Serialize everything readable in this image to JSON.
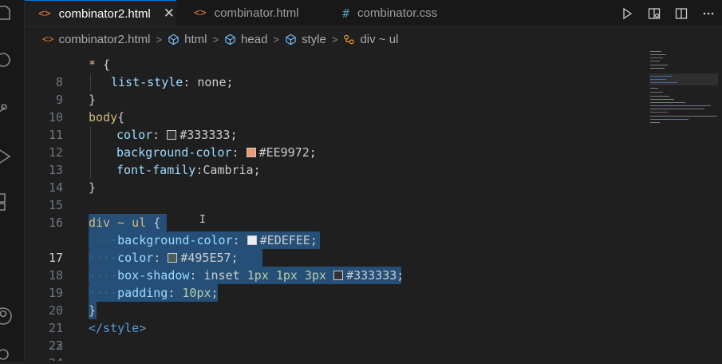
{
  "tabs": [
    {
      "icon": "<>",
      "label": "combinator2.html",
      "active": true,
      "close": "✕"
    },
    {
      "icon": "<>",
      "label": "combinator.html",
      "active": false
    },
    {
      "icon": "#",
      "label": "combinator.css",
      "active": false
    }
  ],
  "breadcrumb": [
    "combinator2.html",
    "html",
    "head",
    "style",
    "div ~ ul"
  ],
  "editor": {
    "line_numbers": [
      "8",
      "9",
      "10",
      "11",
      "12",
      "13",
      "14",
      "15",
      "16",
      "17",
      "18",
      "19",
      "20",
      "21",
      "22",
      "23",
      "24"
    ],
    "current_line": "17",
    "code": {
      "l8_sel": "*",
      "l8_brace": " {",
      "l9_prop": "list-style",
      "l9_rest": ": none;",
      "l10": "}",
      "l11_sel": "body",
      "l11_brace": "{",
      "l12_prop": "color",
      "l12_colon": ": ",
      "l12_hex": "#333333",
      "l12_semi": ";",
      "l13_prop": "background-color",
      "l13_colon": ": ",
      "l13_hex": "#EE9972",
      "l13_semi": ";",
      "l14_prop": "font-family",
      "l14_rest": ":Cambria;",
      "l17_sel": "div ~ ul",
      "l17_brace": " {",
      "l18_prop": "background-color",
      "l18_colon": ": ",
      "l18_hex": "#EDEFEE",
      "l18_semi": ";",
      "l19_prop": "color",
      "l19_colon": ": ",
      "l19_hex": "#495E57",
      "l19_semi": ";",
      "l20_prop": "box-shadow",
      "l20_colon": ": ",
      "l20_inset": "inset",
      "l20_n1": "1px",
      "l20_n2": "1px",
      "l20_n3": "3px",
      "l20_hex": "#333333",
      "l20_semi": ";",
      "l21_prop": "padding",
      "l21_colon": ": ",
      "l21_num": "10px",
      "l21_semi": ";",
      "l22": "}",
      "l23": "</style>"
    }
  },
  "colors": {
    "swatch_333333": "#333333",
    "swatch_EE9972": "#EE9972",
    "swatch_EDEFEE": "#EDEFEE",
    "swatch_495E57": "#495E57",
    "selection": "#264f78",
    "accent": "#0078d4"
  },
  "icons": {
    "activity": [
      "files-icon",
      "search-icon",
      "source-control-icon",
      "run-debug-icon",
      "extensions-icon",
      "account-icon",
      "settings-icon"
    ],
    "toolbar": [
      "run-icon",
      "open-preview-icon",
      "split-editor-icon",
      "more-actions-icon"
    ]
  }
}
